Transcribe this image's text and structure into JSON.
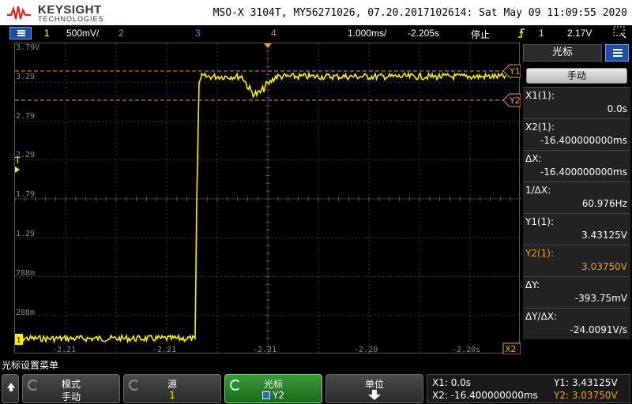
{
  "header": {
    "brand": "KEYSIGHT",
    "brand_sub": "TECHNOLOGIES",
    "info": "MSO-X 3104T, MY56271026, 07.20.2017102614: Sat May 09 11:09:55 2020"
  },
  "status": {
    "ch1_num": "1",
    "ch1_scale": "500mV/",
    "ch2_num": "2",
    "ch3_num": "3",
    "ch4_num": "4",
    "timebase": "1.000ms/",
    "delay": "-2.205s",
    "run_state": "停止",
    "trig_ch": "1",
    "trig_level": "2.17V"
  },
  "screen": {
    "y_labels": [
      "3.79V",
      "3.29",
      "2.79",
      "2.29",
      "1.79",
      "1.29",
      "788m",
      "288m"
    ],
    "x_labels": [
      "-2.21",
      "-2.21",
      "-2.21",
      "-2.20",
      "-2.20s"
    ],
    "markers": {
      "y1": "Y1",
      "y2": "Y2",
      "x1": "X1",
      "x2": "X2",
      "ch": "1",
      "trig": "T"
    },
    "colors": {
      "trace": "#ffee00",
      "cursor": "#f0a020",
      "grid": "#3a3a3a"
    }
  },
  "panel": {
    "title": "光标",
    "mode": "手动",
    "rows": [
      {
        "label": "X1(1):",
        "value": "0.0s",
        "orange": false
      },
      {
        "label": "X2(1):",
        "value": "-16.400000000ms",
        "orange": false
      },
      {
        "label": "ΔX:",
        "value": "-16.400000000ms",
        "orange": false
      },
      {
        "label": "1/ΔX:",
        "value": "60.976Hz",
        "orange": false
      },
      {
        "label": "Y1(1):",
        "value": "3.43125V",
        "orange": false
      },
      {
        "label": "Y2(1):",
        "value": "3.03750V",
        "orange": true
      },
      {
        "label": "ΔY:",
        "value": "-393.75mV",
        "orange": false
      },
      {
        "label": "ΔY/ΔX:",
        "value": "-24.0091V/s",
        "orange": false
      }
    ]
  },
  "softkeys": {
    "menu_title": "光标设置菜单",
    "mode_title": "模式",
    "mode_value": "手动",
    "source_title": "源",
    "source_value": "1",
    "cursor_title": "光标",
    "cursor_value": "Y2",
    "units_title": "单位"
  },
  "readout": {
    "x1": "X1: 0.0s",
    "x2": "X2: -16.400000000ms",
    "y1": "Y1: 3.43125V",
    "y2": "Y2: 3.03750V"
  }
}
